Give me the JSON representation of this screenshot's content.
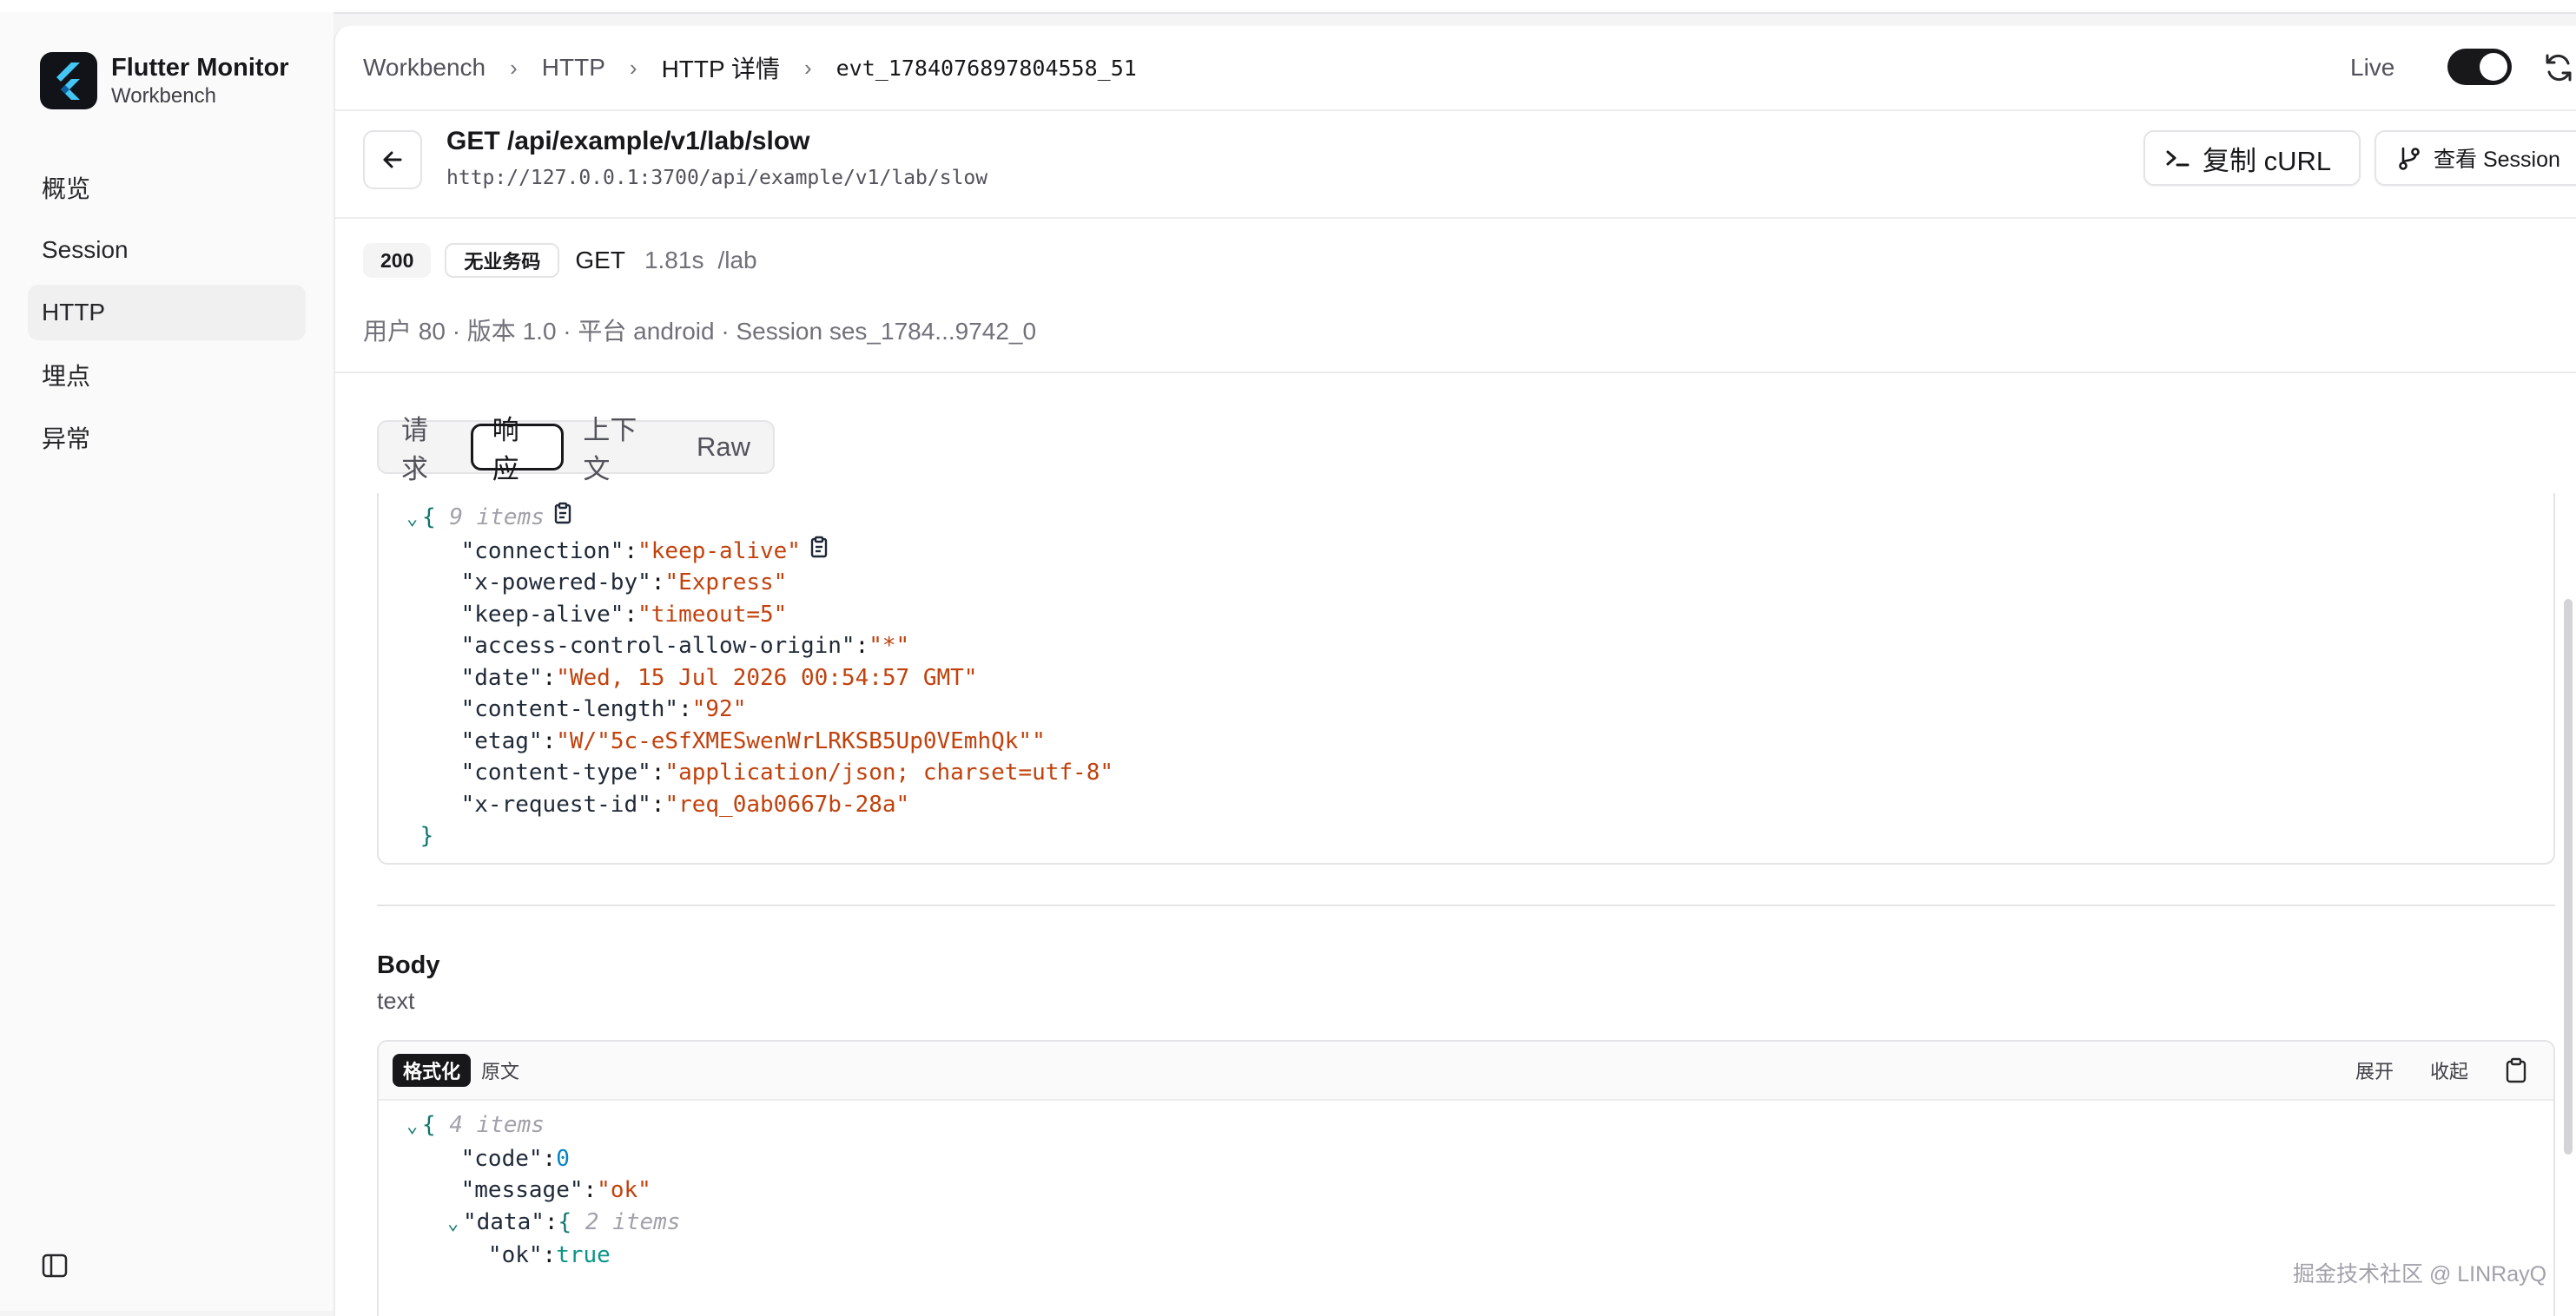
{
  "app": {
    "name": "Flutter Monitor",
    "subtitle": "Workbench"
  },
  "sidebar": {
    "items": [
      {
        "label": "概览"
      },
      {
        "label": "Session"
      },
      {
        "label": "HTTP",
        "active": true
      },
      {
        "label": "埋点"
      },
      {
        "label": "异常"
      }
    ]
  },
  "breadcrumb": [
    "Workbench",
    "HTTP",
    "HTTP 详情",
    "evt_1784076897804558_51"
  ],
  "header": {
    "live_label": "Live",
    "live_on": true
  },
  "request": {
    "title": "GET /api/example/v1/lab/slow",
    "url": "http://127.0.0.1:3700/api/example/v1/lab/slow",
    "copy_curl_label": "复制 cURL",
    "view_session_label": "查看 Session",
    "status_code": "200",
    "biz_code_label": "无业务码",
    "method": "GET",
    "duration": "1.81s",
    "path": "/lab",
    "meta_line": "用户 80 · 版本 1.0 · 平台 android · Session ses_1784...9742_0"
  },
  "tabs": [
    {
      "label": "请求"
    },
    {
      "label": "响应",
      "active": true
    },
    {
      "label": "上下文"
    },
    {
      "label": "Raw"
    }
  ],
  "response_headers": {
    "count_label": "9 items",
    "entries": [
      {
        "key": "\"connection\"",
        "value": "\"keep-alive\""
      },
      {
        "key": "\"x-powered-by\"",
        "value": "\"Express\""
      },
      {
        "key": "\"keep-alive\"",
        "value": "\"timeout=5\""
      },
      {
        "key": "\"access-control-allow-origin\"",
        "value": "\"*\""
      },
      {
        "key": "\"date\"",
        "value": "\"Wed, 15 Jul 2026 00:54:57 GMT\""
      },
      {
        "key": "\"content-length\"",
        "value": "\"92\""
      },
      {
        "key": "\"etag\"",
        "value": "\"W/\"5c-eSfXMESwenWrLRKSB5Up0VEmhQk\"\""
      },
      {
        "key": "\"content-type\"",
        "value": "\"application/json; charset=utf-8\""
      },
      {
        "key": "\"x-request-id\"",
        "value": "\"req_0ab0667b-28a\""
      }
    ]
  },
  "body": {
    "title": "Body",
    "type": "text",
    "format_label": "格式化",
    "raw_label": "原文",
    "expand_label": "展开",
    "collapse_label": "收起",
    "count_label": "4 items",
    "entries": [
      {
        "key": "\"code\"",
        "value": "0"
      },
      {
        "key": "\"message\"",
        "value": "\"ok\""
      }
    ],
    "data_key": "\"data\"",
    "data_count_label": "2 items",
    "data_entries": [
      {
        "key": "\"ok\"",
        "value": "true"
      }
    ]
  },
  "watermark": "掘金技术社区 @ LINRayQ",
  "colors": {
    "accent": "#18181b",
    "string": "#c2410c",
    "number": "#0284c7",
    "boolean": "#0d9488"
  }
}
